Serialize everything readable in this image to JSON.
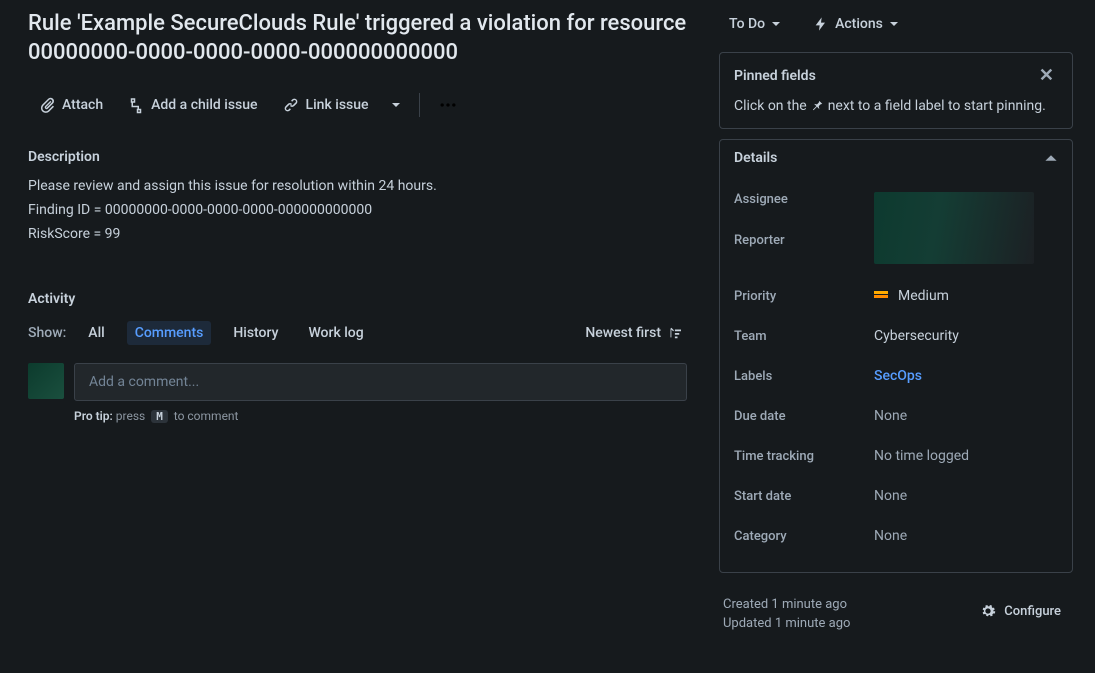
{
  "issue": {
    "title": "Rule 'Example SecureClouds Rule' triggered a violation for resource 00000000-0000-0000-0000-000000000000"
  },
  "toolbar": {
    "attach": "Attach",
    "add_child": "Add a child issue",
    "link_issue": "Link issue"
  },
  "description": {
    "heading": "Description",
    "line1": "Please review and assign this issue for resolution within 24 hours.",
    "line2": "Finding ID = 00000000-0000-0000-0000-000000000000",
    "line3": "RiskScore = 99"
  },
  "activity": {
    "heading": "Activity",
    "show_label": "Show:",
    "tabs": {
      "all": "All",
      "comments": "Comments",
      "history": "History",
      "worklog": "Work log"
    },
    "sort": "Newest first",
    "comment_placeholder": "Add a comment...",
    "protip_prefix": "Pro tip:",
    "protip_press": "press",
    "protip_key": "M",
    "protip_suffix": "to comment"
  },
  "status": {
    "label": "To Do"
  },
  "actions": {
    "label": "Actions"
  },
  "pinned": {
    "heading": "Pinned fields",
    "body_before": "Click on the ",
    "body_after": " next to a field label to start pinning."
  },
  "details": {
    "heading": "Details",
    "assignee": {
      "label": "Assignee"
    },
    "reporter": {
      "label": "Reporter"
    },
    "priority": {
      "label": "Priority",
      "value": "Medium"
    },
    "team": {
      "label": "Team",
      "value": "Cybersecurity"
    },
    "labels": {
      "label": "Labels",
      "value": "SecOps"
    },
    "due_date": {
      "label": "Due date",
      "value": "None"
    },
    "time_tracking": {
      "label": "Time tracking",
      "value": "No time logged"
    },
    "start_date": {
      "label": "Start date",
      "value": "None"
    },
    "category": {
      "label": "Category",
      "value": "None"
    }
  },
  "meta": {
    "created": "Created 1 minute ago",
    "updated": "Updated 1 minute ago",
    "configure": "Configure"
  }
}
